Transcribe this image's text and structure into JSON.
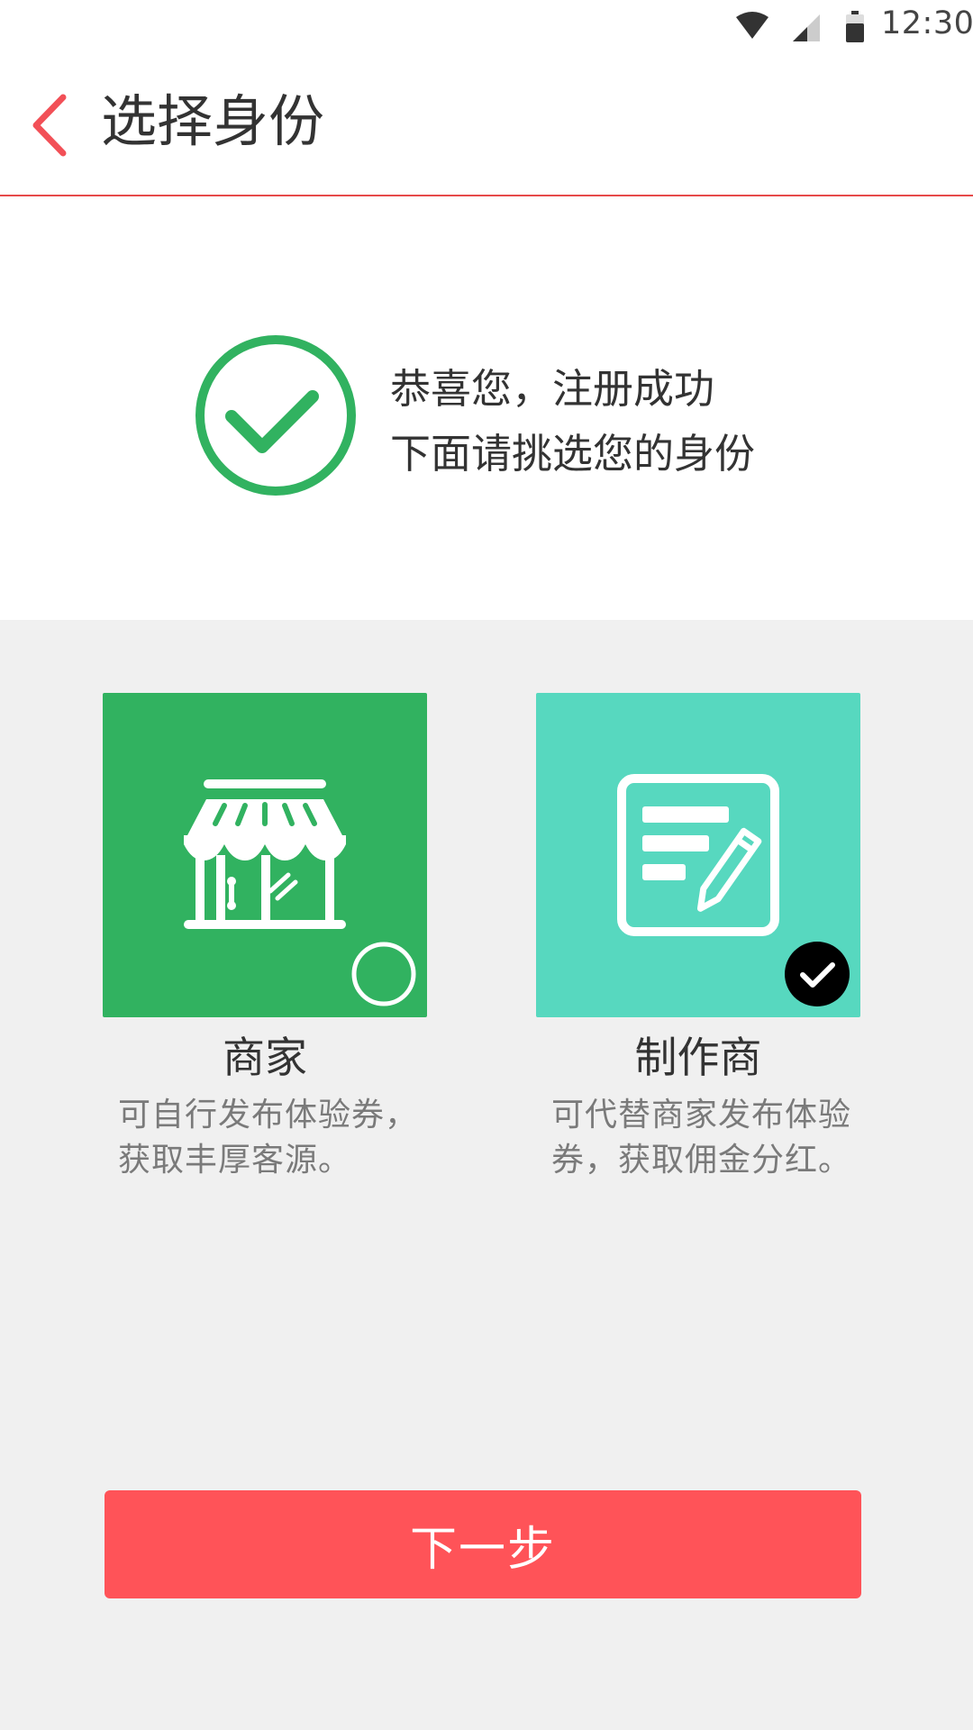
{
  "status_bar": {
    "time": "12:30",
    "icons": [
      "wifi-icon",
      "cellular-signal-icon",
      "battery-icon"
    ]
  },
  "header": {
    "back_icon": "chevron-left-icon",
    "title": "选择身份"
  },
  "success": {
    "icon": "check-circle-icon",
    "line1": "恭喜您，注册成功",
    "line2": "下面请挑选您的身份"
  },
  "roles": [
    {
      "icon": "storefront-icon",
      "name": "商家",
      "description": "可自行发布体验券，获取丰厚客源。",
      "selected": false,
      "color": "#31b260"
    },
    {
      "icon": "document-edit-icon",
      "name": "制作商",
      "description": "可代替商家发布体验券，获取佣金分红。",
      "selected": true,
      "color": "#57d8bf"
    }
  ],
  "next_button": {
    "label": "下一步"
  },
  "colors": {
    "accent_red": "#ff5358",
    "success_green": "#31b260",
    "background": "#f0f0f0"
  }
}
